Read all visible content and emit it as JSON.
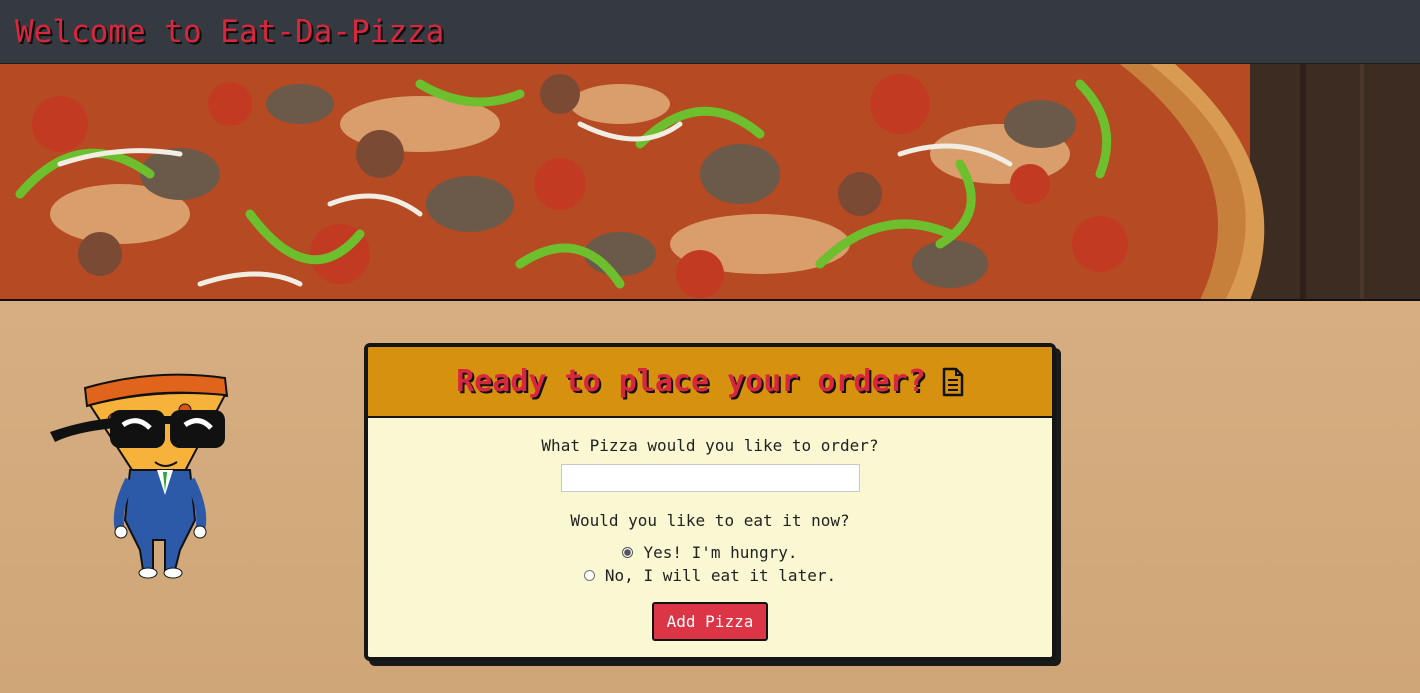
{
  "header": {
    "title": "Welcome to Eat-Da-Pizza"
  },
  "card": {
    "title": "Ready to place your order?",
    "pizza_question": "What Pizza would you like to order?",
    "pizza_input_value": "",
    "eat_question": "Would you like to eat it now?",
    "options": [
      {
        "label": "Yes! I'm hungry.",
        "checked": true
      },
      {
        "label": "No, I will eat it later.",
        "checked": false
      }
    ],
    "submit_label": "Add Pizza"
  },
  "colors": {
    "navbar": "#343a40",
    "title_red": "#d7263d",
    "card_header": "#d6910f",
    "card_body": "#f9f8d3",
    "button": "#dc3545",
    "background": "#d9b185"
  },
  "icons": {
    "title_icon": "document-icon"
  }
}
